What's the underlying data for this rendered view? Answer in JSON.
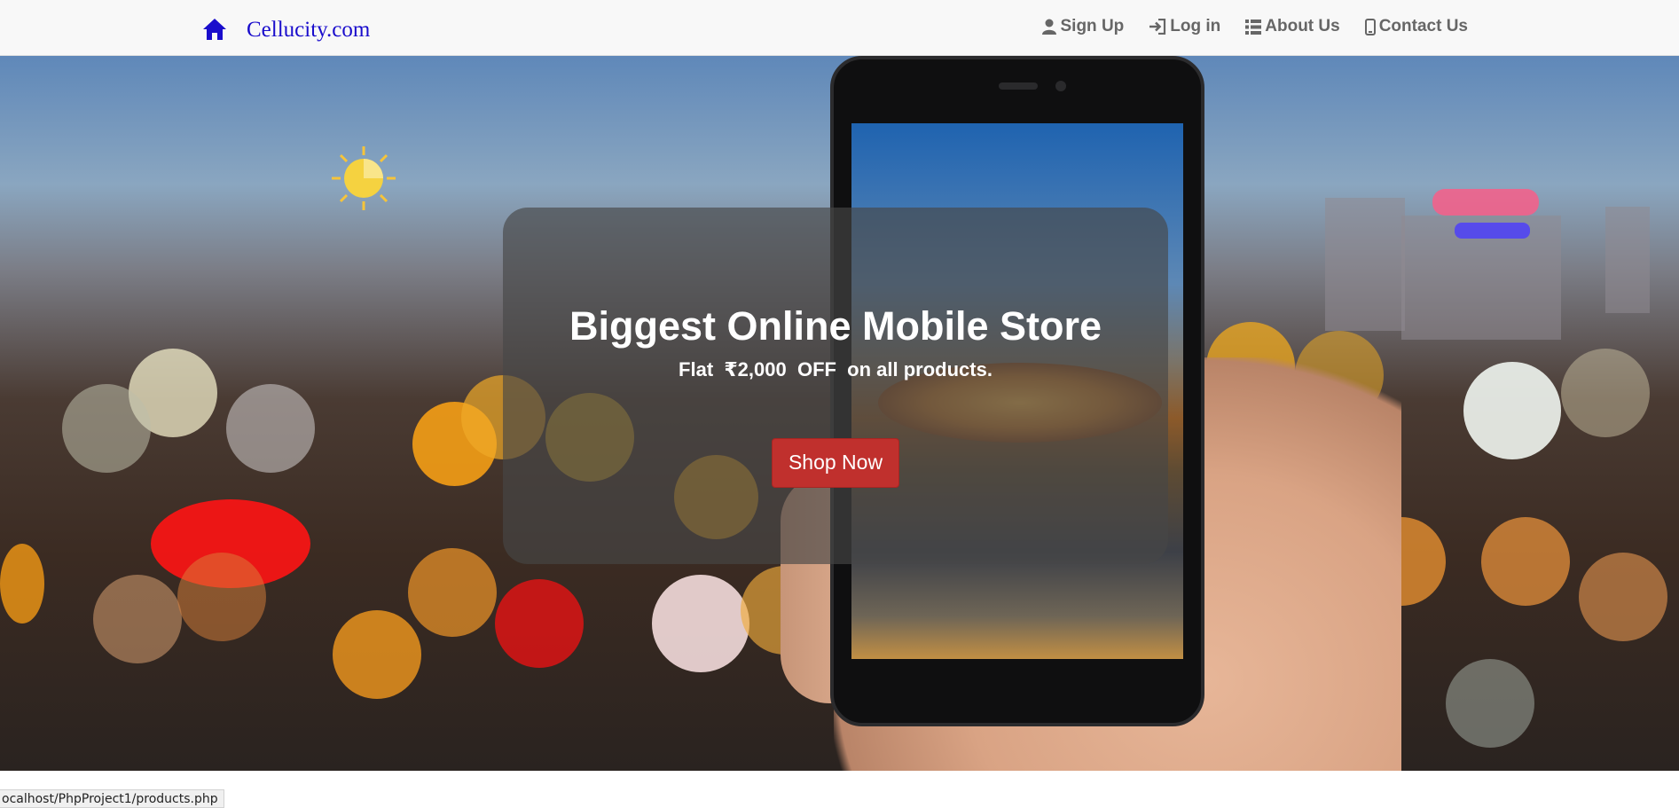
{
  "navbar": {
    "brand": "Cellucity.com",
    "links": [
      {
        "label": "Sign Up",
        "icon": "user-icon"
      },
      {
        "label": "Log in",
        "icon": "login-icon"
      },
      {
        "label": "About Us",
        "icon": "list-icon"
      },
      {
        "label": "Contact Us",
        "icon": "mobile-icon"
      }
    ],
    "home_icon": "home-icon",
    "brand_color": "#1a0dcc"
  },
  "hero": {
    "title": "Biggest Online Mobile Store",
    "subtitle": "Flat  ₹2,000  OFF  on all products.",
    "cta_label": "Shop Now",
    "cta_color": "#c0302d"
  },
  "status_bar": {
    "url": "ocalhost/PhpProject1/products.php"
  }
}
